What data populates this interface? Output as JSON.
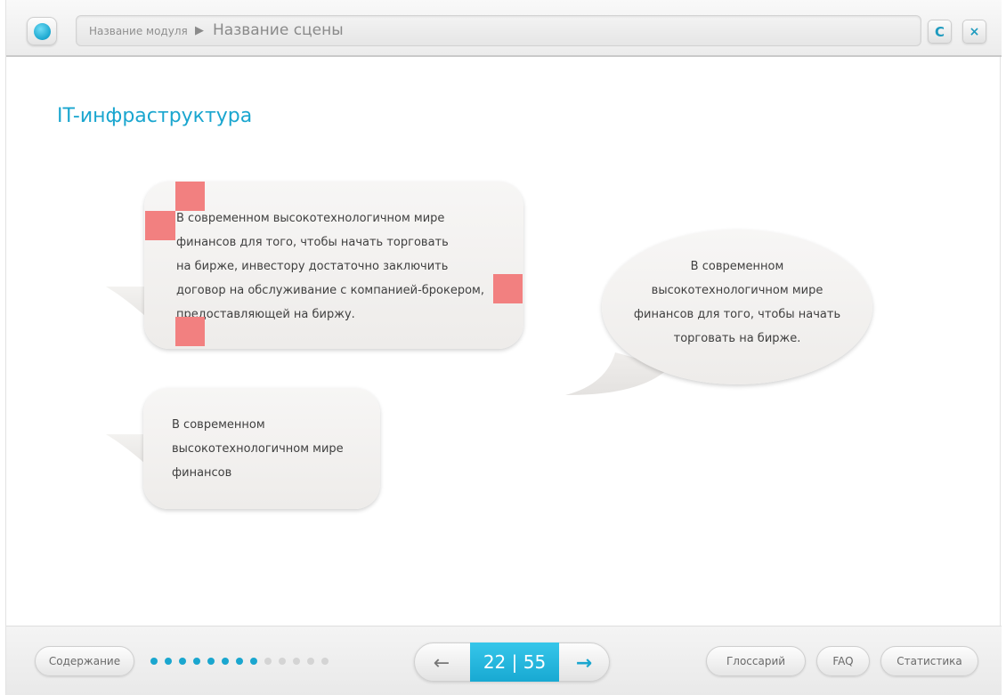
{
  "header": {
    "module_name": "Название модуля",
    "separator": "▶",
    "scene_name": "Название сцены",
    "reload_icon": "reload-icon",
    "close_icon": "close-icon",
    "reload_glyph": "C",
    "close_glyph": "×"
  },
  "main": {
    "title": "IT-инфраструктура",
    "bubbles": [
      {
        "lines": [
          "В современном высокотехнологичном мире",
          "финансов для того, чтобы начать торговать",
          "на бирже, инвестору достаточно заключить",
          "договор на обслуживание с компанией-брокером,",
          "предоставляющей на биржу."
        ]
      },
      {
        "lines": [
          "В современном",
          "высокотехнологичном мире",
          "финансов для того, чтобы начать",
          "торговать на бирже."
        ]
      },
      {
        "lines": [
          "В современном",
          "высокотехнологичном мире",
          "финансов"
        ]
      }
    ]
  },
  "footer": {
    "contents_label": "Содержание",
    "progress": {
      "total_dots": 13,
      "filled_dots": 8
    },
    "prev_arrow": "←",
    "next_arrow": "→",
    "page_counter": "22 | 55",
    "glossary_label": "Глоссарий",
    "faq_label": "FAQ",
    "stats_label": "Статистика"
  },
  "colors": {
    "accent": "#1aa6cf",
    "marker": "#f28080",
    "dot_filled": "#1aa6cf",
    "dot_empty": "#d4d4d4"
  }
}
